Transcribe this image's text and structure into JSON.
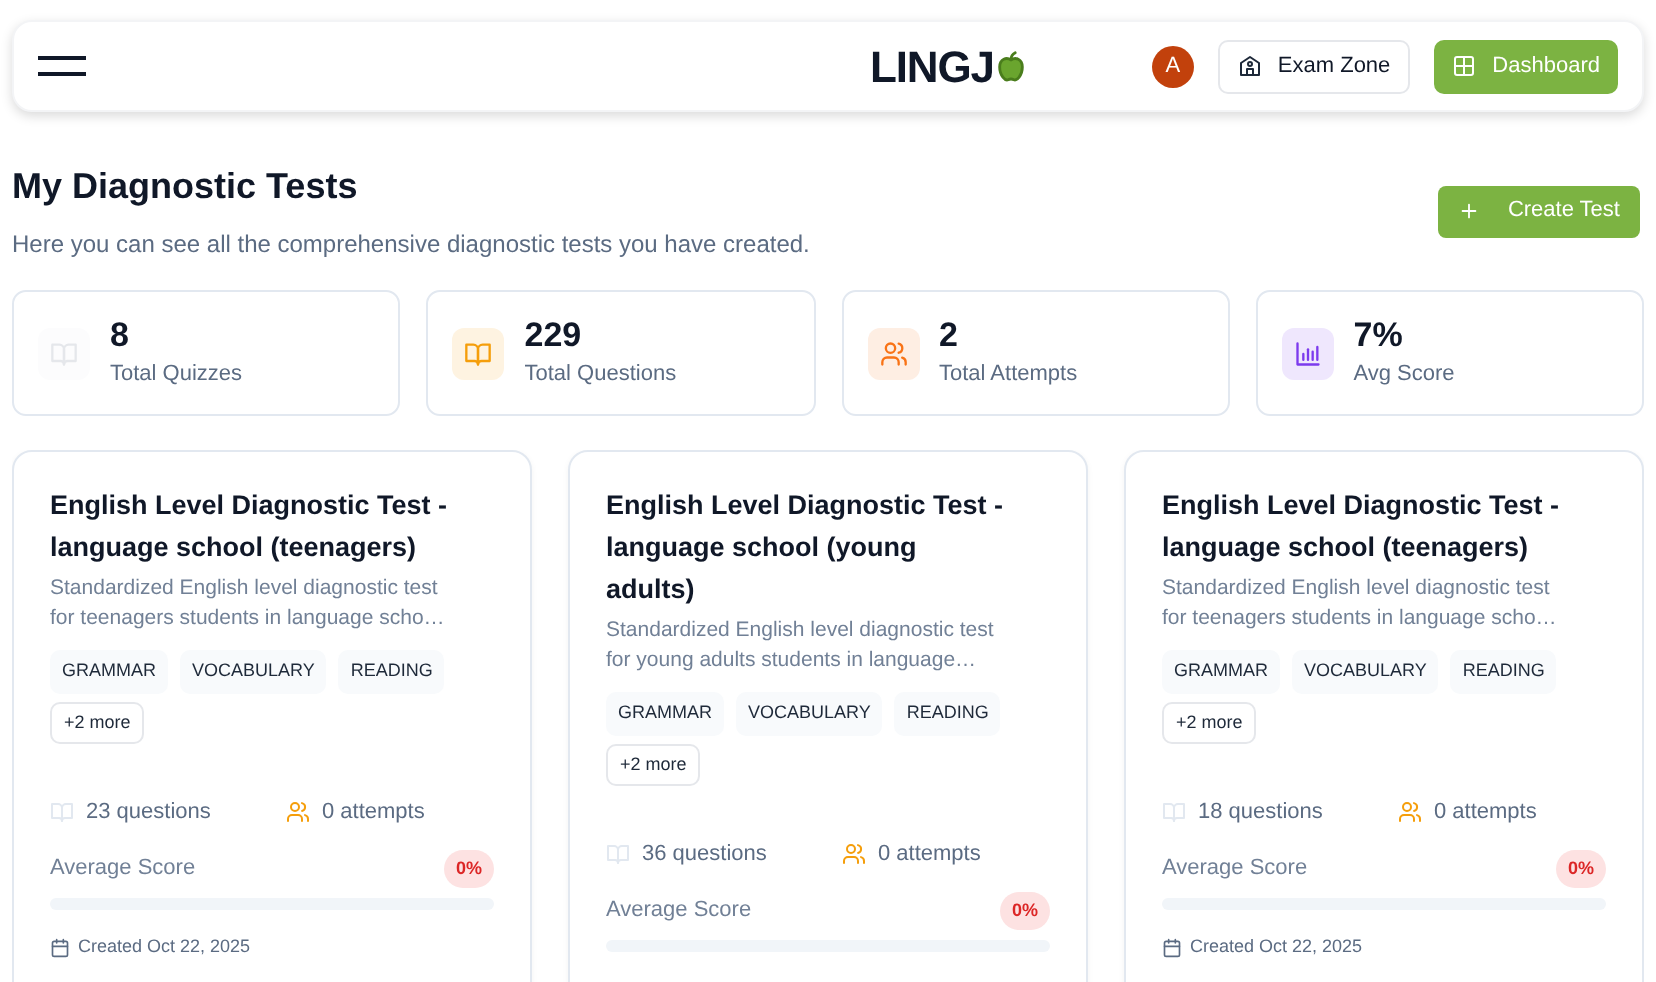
{
  "header": {
    "logo": "LINGJ",
    "avatar": "A",
    "exam_zone": "Exam Zone",
    "dashboard": "Dashboard"
  },
  "page": {
    "title": "My Diagnostic Tests",
    "subtitle": "Here you can see all the comprehensive diagnostic tests you have created.",
    "create_button": "Create Test"
  },
  "stats": [
    {
      "kind": "book",
      "value": "8",
      "label": "Total Quizzes",
      "color": "#e5e7eb"
    },
    {
      "kind": "book",
      "value": "229",
      "label": "Total Questions",
      "color": "#f59e0b"
    },
    {
      "kind": "users",
      "value": "2",
      "label": "Total Attempts",
      "color": "#f97316"
    },
    {
      "kind": "chart",
      "value": "7%",
      "label": "Avg Score",
      "color": "#7c3aed"
    }
  ],
  "tests": [
    {
      "title": "English Level Diagnostic Test - language school (teenagers)",
      "description": "Standardized English level diagnostic test for teenagers students in language scho…",
      "tags": [
        "GRAMMAR",
        "VOCABULARY",
        "READING"
      ],
      "more": "+2 more",
      "questions": "23 questions",
      "attempts": "0 attempts",
      "score_label": "Average Score",
      "score": "0%",
      "level": 0,
      "created": "Created Oct 22, 2025"
    },
    {
      "title": "English Level Diagnostic Test - language school (young adults)",
      "description": "Standardized English level diagnostic test for young adults students in language…",
      "tags": [
        "GRAMMAR",
        "VOCABULARY",
        "READING"
      ],
      "more": "+2 more",
      "questions": "36 questions",
      "attempts": "0 attempts",
      "score_label": "Average Score",
      "score": "0%",
      "level": 0
    },
    {
      "title": "English Level Diagnostic Test - language school (teenagers)",
      "description": "Standardized English level diagnostic test for teenagers students in language scho…",
      "tags": [
        "GRAMMAR",
        "VOCABULARY",
        "READING"
      ],
      "more": "+2 more",
      "questions": "18 questions",
      "attempts": "0 attempts",
      "score_label": "Average Score",
      "score": "0%",
      "level": 0,
      "created": "Created Oct 22, 2025"
    }
  ]
}
